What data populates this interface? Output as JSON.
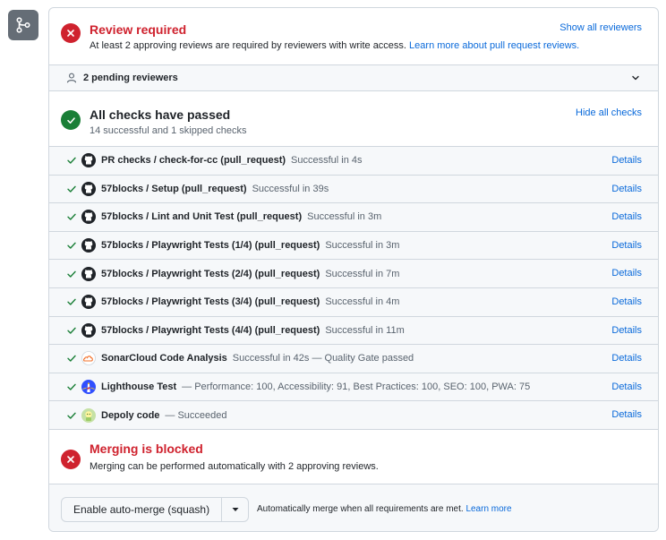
{
  "review": {
    "title": "Review required",
    "description": "At least 2 approving reviews are required by reviewers with write access.",
    "learn_more": "Learn more about pull request reviews.",
    "show_all": "Show all reviewers"
  },
  "pending": {
    "label": "2 pending reviewers"
  },
  "checks": {
    "title": "All checks have passed",
    "subtitle": "14 successful and 1 skipped checks",
    "hide_all": "Hide all checks",
    "details_label": "Details",
    "items": [
      {
        "name": "PR checks / check-for-cc (pull_request)",
        "desc": "Successful in 4s",
        "icon": "github-icon"
      },
      {
        "name": "57blocks / Setup (pull_request)",
        "desc": "Successful in 39s",
        "icon": "github-icon"
      },
      {
        "name": "57blocks / Lint and Unit Test (pull_request)",
        "desc": "Successful in 3m",
        "icon": "github-icon"
      },
      {
        "name": "57blocks / Playwright Tests (1/4) (pull_request)",
        "desc": "Successful in 3m",
        "icon": "github-icon"
      },
      {
        "name": "57blocks / Playwright Tests (2/4) (pull_request)",
        "desc": "Successful in 7m",
        "icon": "github-icon"
      },
      {
        "name": "57blocks / Playwright Tests (3/4) (pull_request)",
        "desc": "Successful in 4m",
        "icon": "github-icon"
      },
      {
        "name": "57blocks / Playwright Tests (4/4) (pull_request)",
        "desc": "Successful in 11m",
        "icon": "github-icon"
      },
      {
        "name": "SonarCloud Code Analysis",
        "desc": "Successful in 42s — Quality Gate passed",
        "icon": "sonarcloud-icon"
      },
      {
        "name": "Lighthouse Test",
        "desc": "— Performance: 100, Accessibility: 91, Best Practices: 100, SEO: 100, PWA: 75",
        "icon": "lighthouse-icon"
      },
      {
        "name": "Depoly code",
        "desc": "— Succeeded",
        "icon": "deploy-bot-icon"
      }
    ]
  },
  "merge": {
    "title": "Merging is blocked",
    "description": "Merging can be performed automatically with 2 approving reviews.",
    "button_label": "Enable auto-merge (squash)",
    "auto_text": "Automatically merge when all requirements are met.",
    "learn_more": "Learn more"
  },
  "colors": {
    "danger": "#cf222e",
    "success": "#1a7f37",
    "link": "#0969da",
    "border": "#d0d7de",
    "muted_bg": "#f6f8fa"
  }
}
